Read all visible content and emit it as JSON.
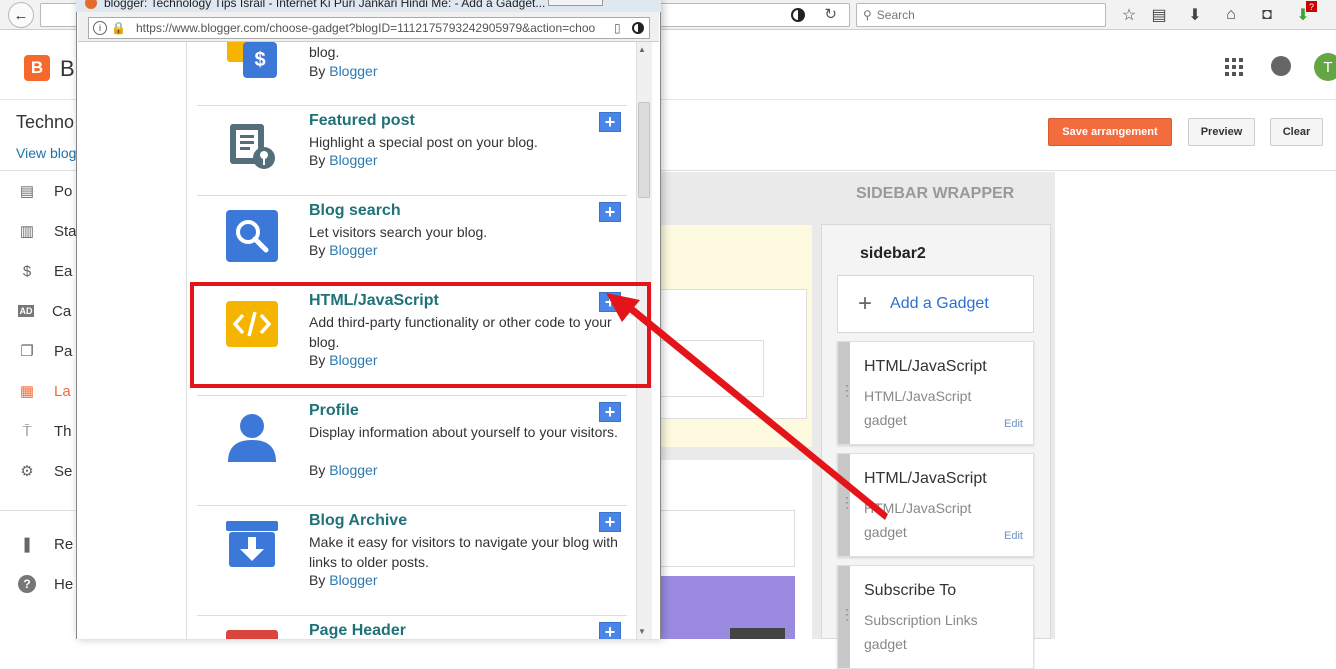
{
  "main_browser": {
    "search_placeholder": "Search",
    "toolbar_icons": [
      "back-icon",
      "star-icon",
      "reading-list-icon",
      "download-icon",
      "home-icon",
      "pocket-icon",
      "addon-icon"
    ],
    "addon_badge": "?"
  },
  "blogger": {
    "logo_letter": "B",
    "brand_partial": "B",
    "blog_title_partial": "Techno",
    "view_blog_partial": "View blog",
    "avatar_letter": "T",
    "buttons": {
      "save": "Save arrangement",
      "preview": "Preview",
      "clear": "Clear"
    },
    "nav_items": [
      {
        "icon": "posts-icon",
        "label": "Po"
      },
      {
        "icon": "stats-icon",
        "label": "Sta"
      },
      {
        "icon": "earnings-icon",
        "label": "Ea"
      },
      {
        "icon": "campaigns-icon",
        "label": "Ca"
      },
      {
        "icon": "pages-icon",
        "label": "Pa"
      },
      {
        "icon": "layout-icon",
        "label": "La"
      },
      {
        "icon": "theme-icon",
        "label": "Th"
      },
      {
        "icon": "settings-icon",
        "label": "Se"
      },
      {
        "icon": "reading-list-icon",
        "label": "Re"
      },
      {
        "icon": "help-icon",
        "label": "He"
      }
    ],
    "sidebar_wrapper_label": "SIDEBAR WRAPPER",
    "sidebar2": {
      "title": "sidebar2",
      "add_gadget": "Add a Gadget",
      "gadgets": [
        {
          "title": "HTML/JavaScript",
          "subtitle": "HTML/JavaScript gadget",
          "edit": "Edit"
        },
        {
          "title": "HTML/JavaScript",
          "subtitle": "HTML/JavaScript gadget",
          "edit": "Edit"
        },
        {
          "title": "Subscribe To",
          "subtitle": "Subscription Links gadget",
          "edit": ""
        }
      ]
    }
  },
  "popup": {
    "title": "blogger: Technology Tips Israil - Internet Ki Puri Jankari Hindi Me: - Add a Gadget...",
    "url": "https://www.blogger.com/choose-gadget?blogID=1112175793242905979&action=choo",
    "top_partial": {
      "desc": "blog.",
      "by": "By",
      "author": "Blogger"
    },
    "gadgets": [
      {
        "name": "Featured post",
        "desc": "Highlight a special post on your blog.",
        "by": "By",
        "author": "Blogger",
        "icon": "featured-post-icon"
      },
      {
        "name": "Blog search",
        "desc": "Let visitors search your blog.",
        "by": "By",
        "author": "Blogger",
        "icon": "search-icon"
      },
      {
        "name": "HTML/JavaScript",
        "desc": "Add third-party functionality or other code to your blog.",
        "by": "By",
        "author": "Blogger",
        "icon": "code-icon"
      },
      {
        "name": "Profile",
        "desc": "Display information about yourself to your visitors.",
        "by": "By",
        "author": "Blogger",
        "icon": "profile-icon"
      },
      {
        "name": "Blog Archive",
        "desc": "Make it easy for visitors to navigate your blog with links to older posts.",
        "by": "By",
        "author": "Blogger",
        "icon": "archive-icon"
      },
      {
        "name": "Page Header",
        "desc": "",
        "by": "",
        "author": "",
        "icon": "page-header-icon"
      }
    ],
    "add_symbol": "+"
  },
  "colors": {
    "accent_orange": "#f36c3d",
    "gadget_title_teal": "#1f7278",
    "add_button_blue": "#4a86e8",
    "highlight_red": "#e3151a"
  }
}
